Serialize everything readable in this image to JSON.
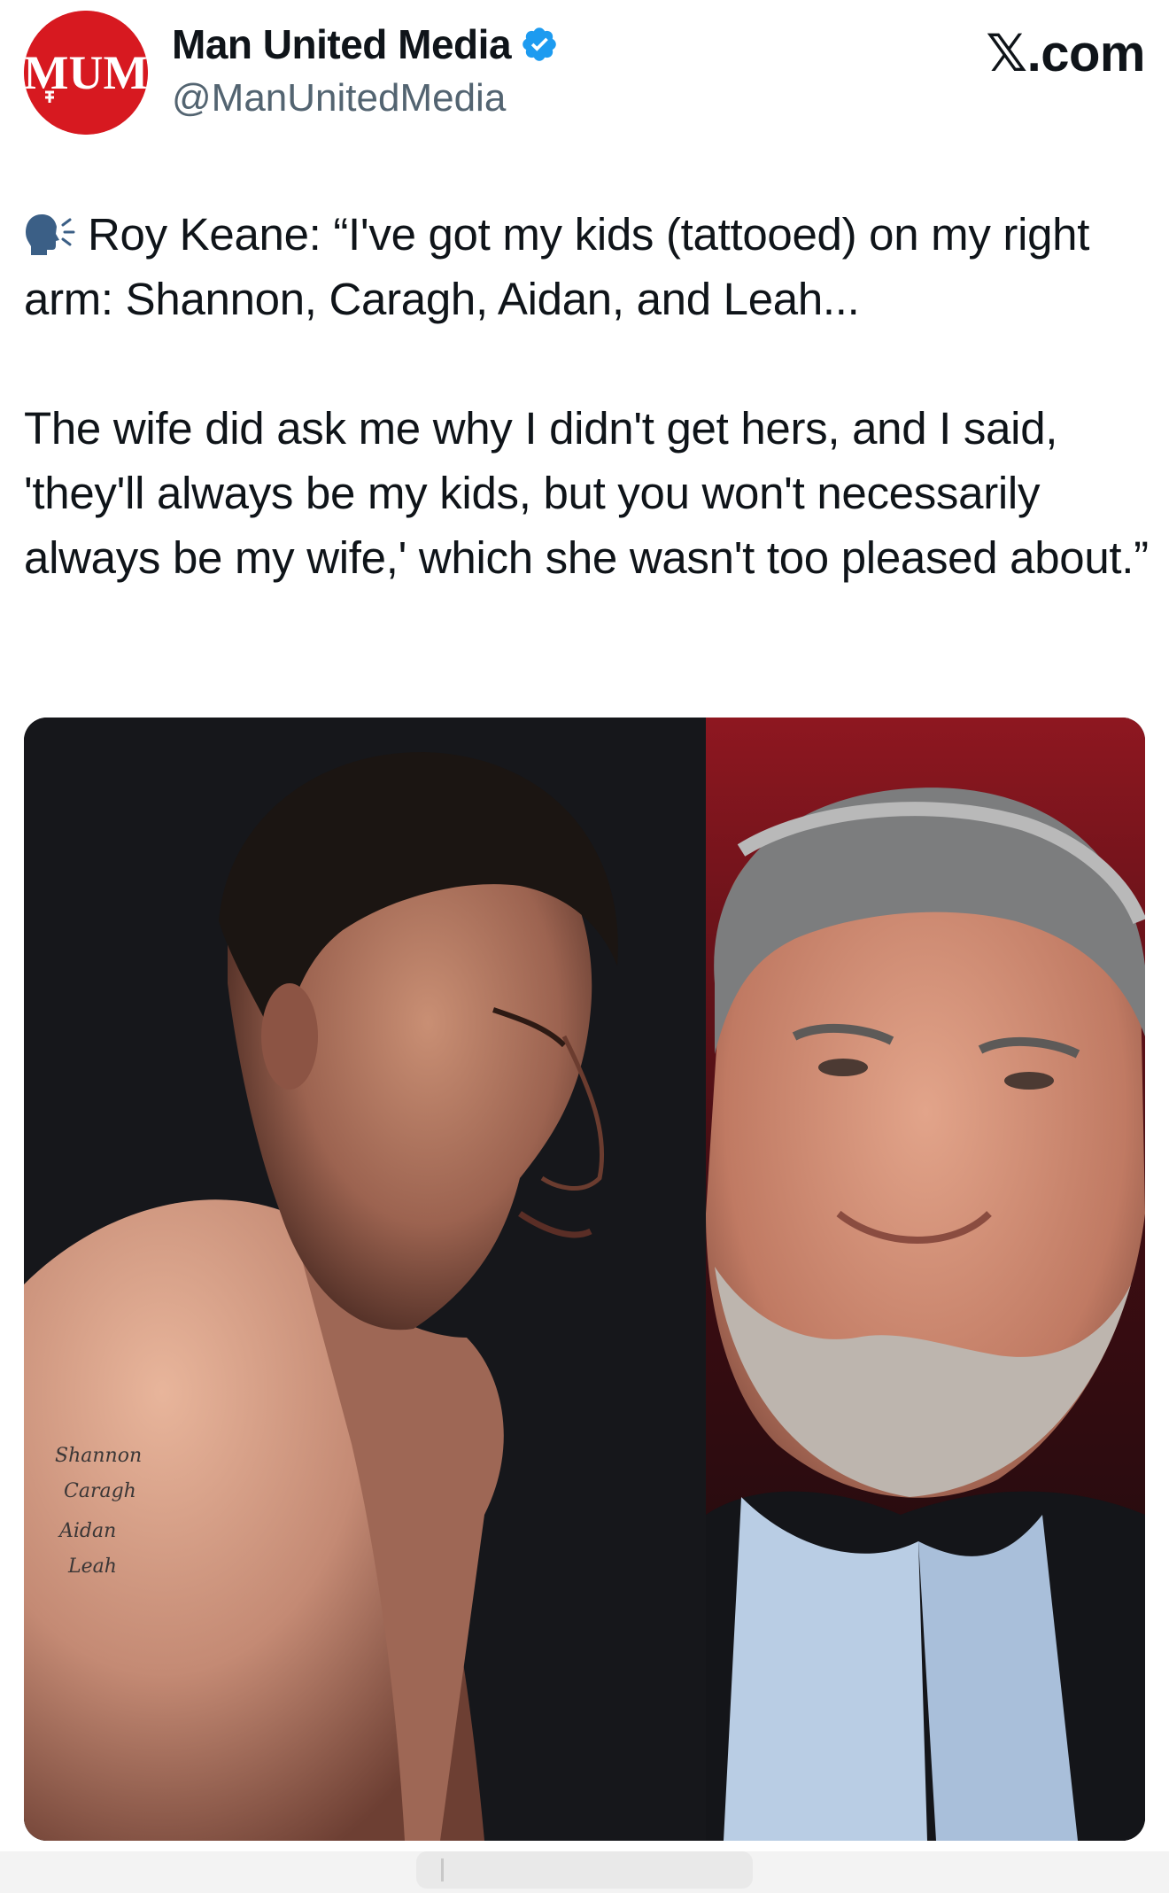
{
  "account": {
    "display_name": "Man United Media",
    "handle": "@ManUnitedMedia",
    "avatar_text": "MUM",
    "verified": true,
    "verified_color": "#1d9bf0",
    "avatar_color": "#d71920"
  },
  "site": {
    "label": "𝕏.com"
  },
  "tweet": {
    "speaker_icon": "speaking-head-icon",
    "paragraph_1": "Roy Keane: “I've got my kids (tattooed) on my right arm: Shannon, Caragh, Aidan, and Leah...",
    "paragraph_2": "The wife did ask me why I didn't get hers, and I said, 'they'll always be my kids, but you won't necessarily always be my wife,' which she wasn't too pleased about.”"
  },
  "media": {
    "tattoo_names": [
      "Shannon",
      "Caragh",
      "Aidan",
      "Leah"
    ]
  }
}
